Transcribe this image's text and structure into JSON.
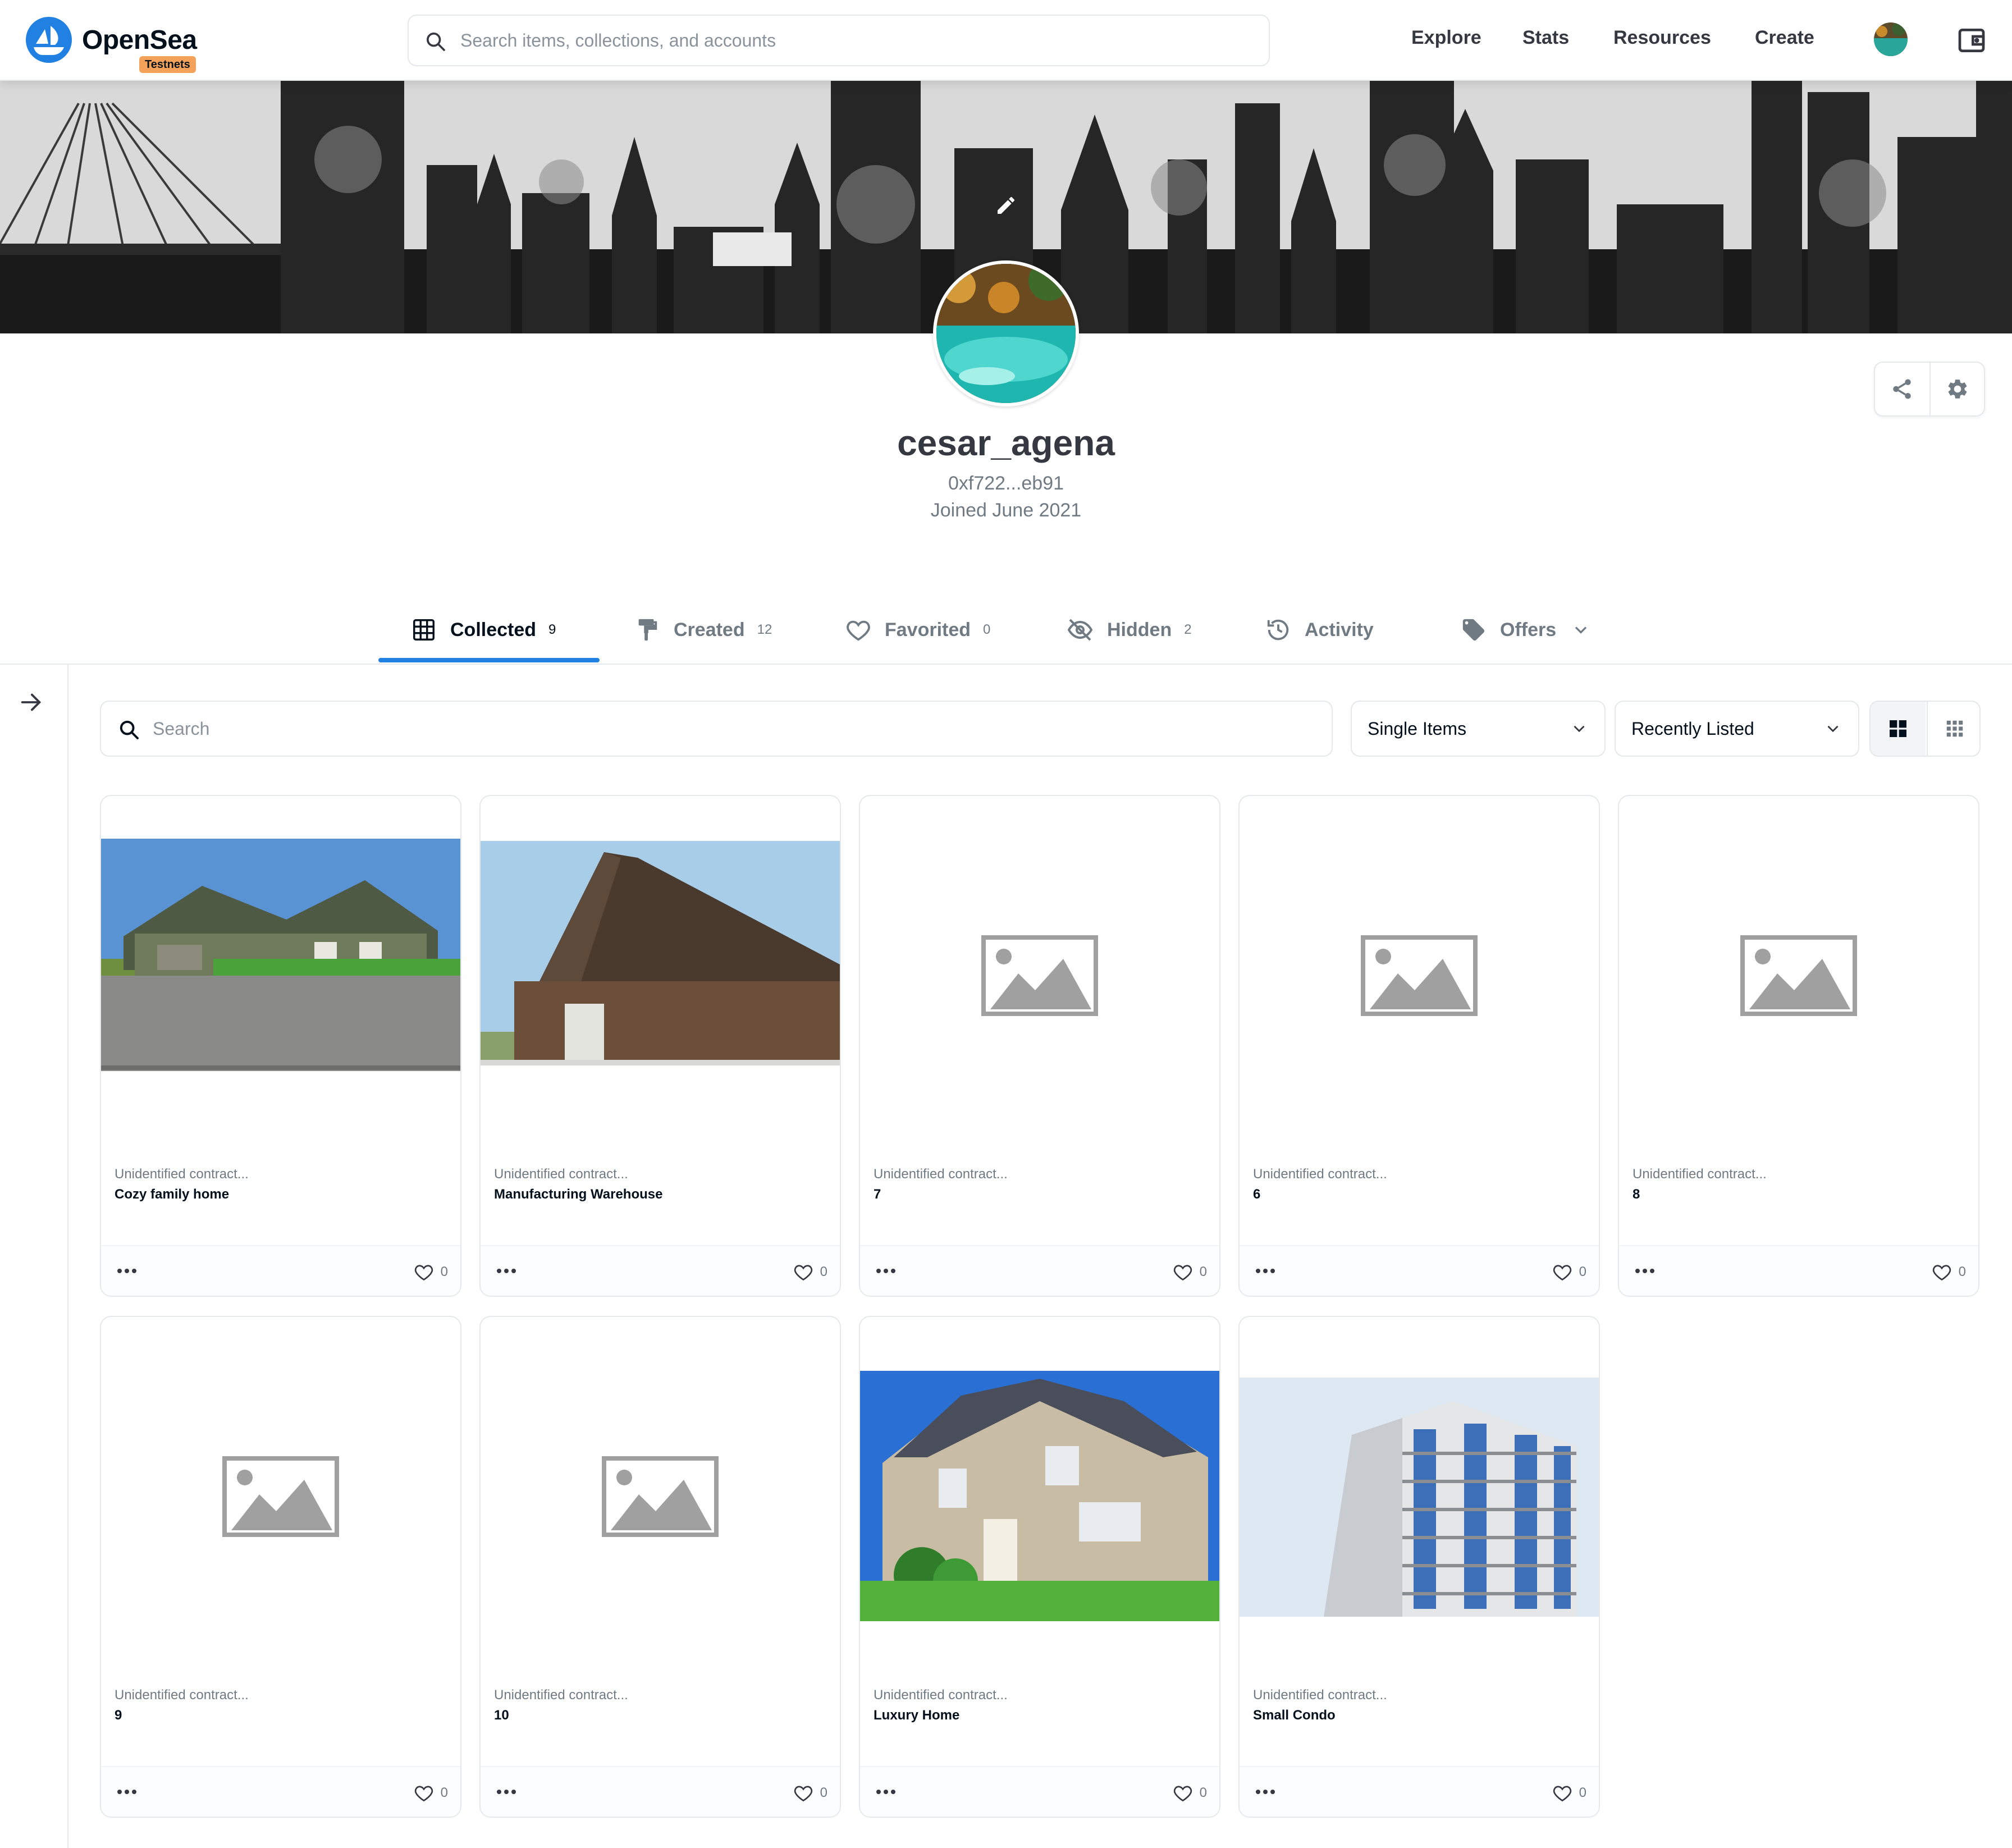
{
  "nav": {
    "brand": "OpenSea",
    "badge": "Testnets",
    "search_placeholder": "Search items, collections, and accounts",
    "links": [
      "Explore",
      "Stats",
      "Resources",
      "Create"
    ]
  },
  "profile": {
    "username": "cesar_agena",
    "address": "0xf722...eb91",
    "joined": "Joined June 2021"
  },
  "tabs": [
    {
      "label": "Collected",
      "count": "9",
      "icon": "grid-icon",
      "active": true
    },
    {
      "label": "Created",
      "count": "12",
      "icon": "paint-roller-icon"
    },
    {
      "label": "Favorited",
      "count": "0",
      "icon": "heart-icon"
    },
    {
      "label": "Hidden",
      "count": "2",
      "icon": "eye-off-icon"
    },
    {
      "label": "Activity",
      "count": "",
      "icon": "history-icon"
    },
    {
      "label": "Offers",
      "count": "",
      "icon": "tag-icon"
    }
  ],
  "filters": {
    "search_placeholder": "Search",
    "item_type": "Single Items",
    "sort": "Recently Listed"
  },
  "items": [
    {
      "contract": "Unidentified contract...",
      "name": "Cozy family home",
      "likes": "0",
      "image": "cozy-home-photo"
    },
    {
      "contract": "Unidentified contract...",
      "name": "Manufacturing Warehouse",
      "likes": "0",
      "image": "warehouse-photo"
    },
    {
      "contract": "Unidentified contract...",
      "name": "7",
      "likes": "0",
      "image": "placeholder-image-icon"
    },
    {
      "contract": "Unidentified contract...",
      "name": "6",
      "likes": "0",
      "image": "placeholder-image-icon"
    },
    {
      "contract": "Unidentified contract...",
      "name": "8",
      "likes": "0",
      "image": "placeholder-image-icon"
    },
    {
      "contract": "Unidentified contract...",
      "name": "9",
      "likes": "0",
      "image": "placeholder-image-icon"
    },
    {
      "contract": "Unidentified contract...",
      "name": "10",
      "likes": "0",
      "image": "placeholder-image-icon"
    },
    {
      "contract": "Unidentified contract...",
      "name": "Luxury Home",
      "likes": "0",
      "image": "luxury-home-photo"
    },
    {
      "contract": "Unidentified contract...",
      "name": "Small Condo",
      "likes": "0",
      "image": "condo-photo"
    }
  ],
  "colors": {
    "accent": "#2081e2",
    "badge": "#f4a259",
    "text_primary": "#04111d",
    "text_secondary": "#707a83",
    "border": "#e5e8eb"
  }
}
